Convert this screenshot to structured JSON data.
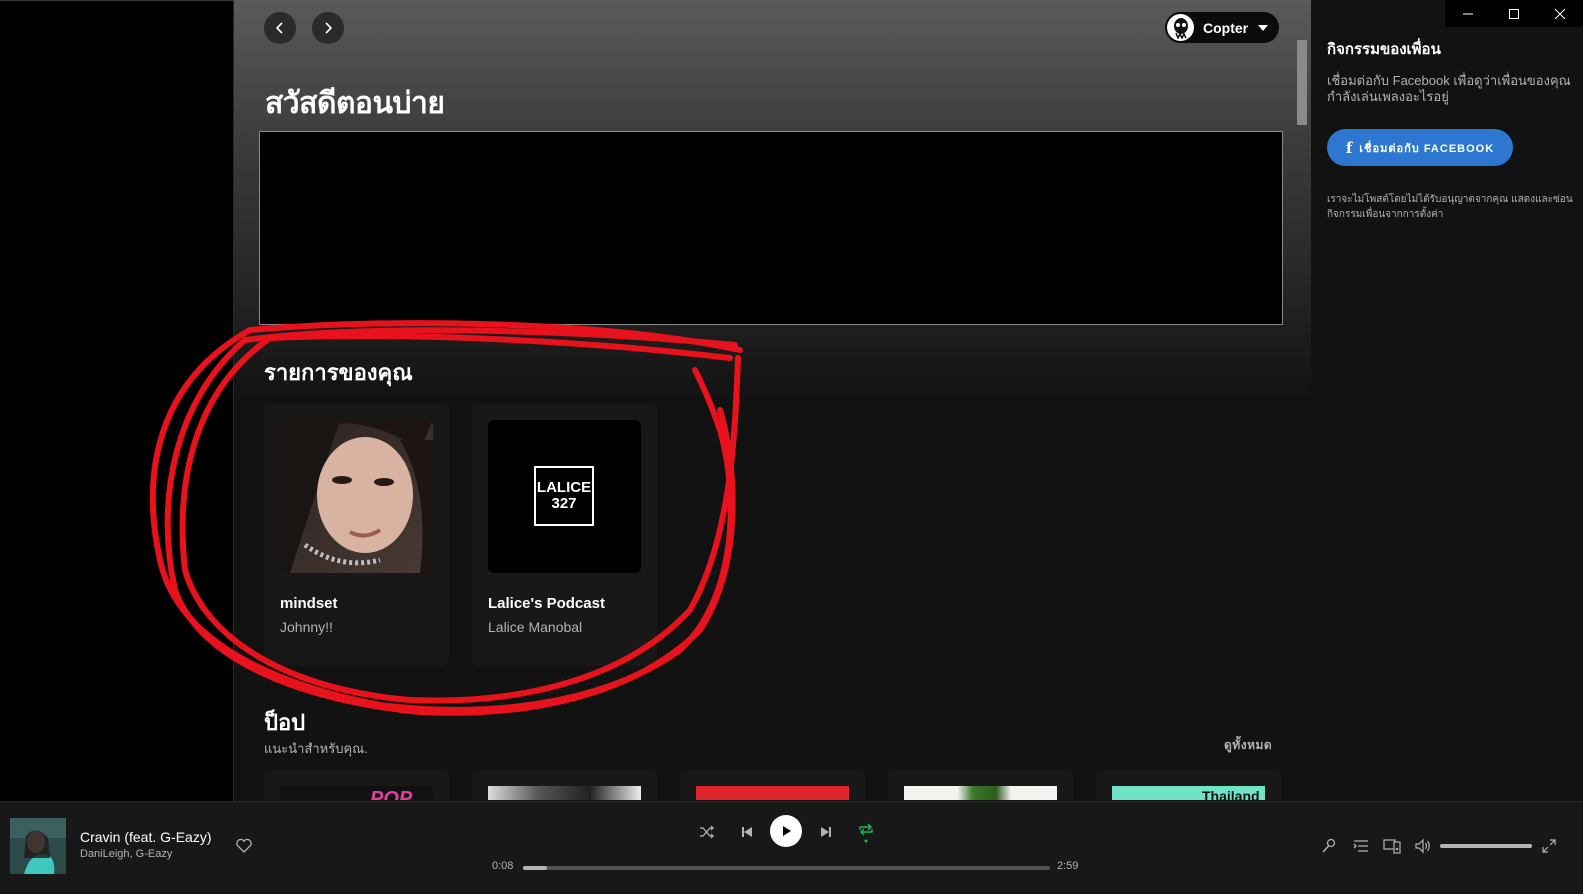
{
  "header": {
    "user_name": "Copter"
  },
  "main": {
    "greeting": "สวัสดีตอนบ่าย",
    "your_items": {
      "title": "รายการของคุณ",
      "cards": [
        {
          "title": "mindset",
          "subtitle": "Johnny!!"
        },
        {
          "title": "Lalice's Podcast",
          "subtitle": "Lalice Manobal",
          "cover_text_1": "LALICE",
          "cover_text_2": "327"
        }
      ]
    },
    "pop_section": {
      "title": "ป็อป",
      "subtitle": "แนะนำสำหรับคุณ.",
      "see_all": "ดูทั้งหมด",
      "card_labels": [
        "POP",
        "",
        "",
        "",
        "Thailand"
      ]
    }
  },
  "friend_activity": {
    "title": "กิจกรรมของเพื่อน",
    "description": "เชื่อมต่อกับ Facebook เพื่อดูว่าเพื่อนของคุณกำลังเล่นเพลงอะไรอยู่",
    "connect_button": "เชื่อมต่อกับ FACEBOOK",
    "note": "เราจะไม่โพสต์โดยไม่ได้รับอนุญาตจากคุณ แสดงและซ่อนกิจกรรมเพื่อนจากการตั้งค่า"
  },
  "player": {
    "track_title": "Cravin (feat. G-Eazy)",
    "track_artist": "DaniLeigh, G-Eazy",
    "elapsed": "0:08",
    "duration": "2:59",
    "progress_fraction": 0.045,
    "volume_fraction": 1.0,
    "repeat_active": true
  },
  "colors": {
    "accent_green": "#1db954",
    "facebook_blue": "#2e77d0",
    "annotation_red": "#e8121c"
  }
}
